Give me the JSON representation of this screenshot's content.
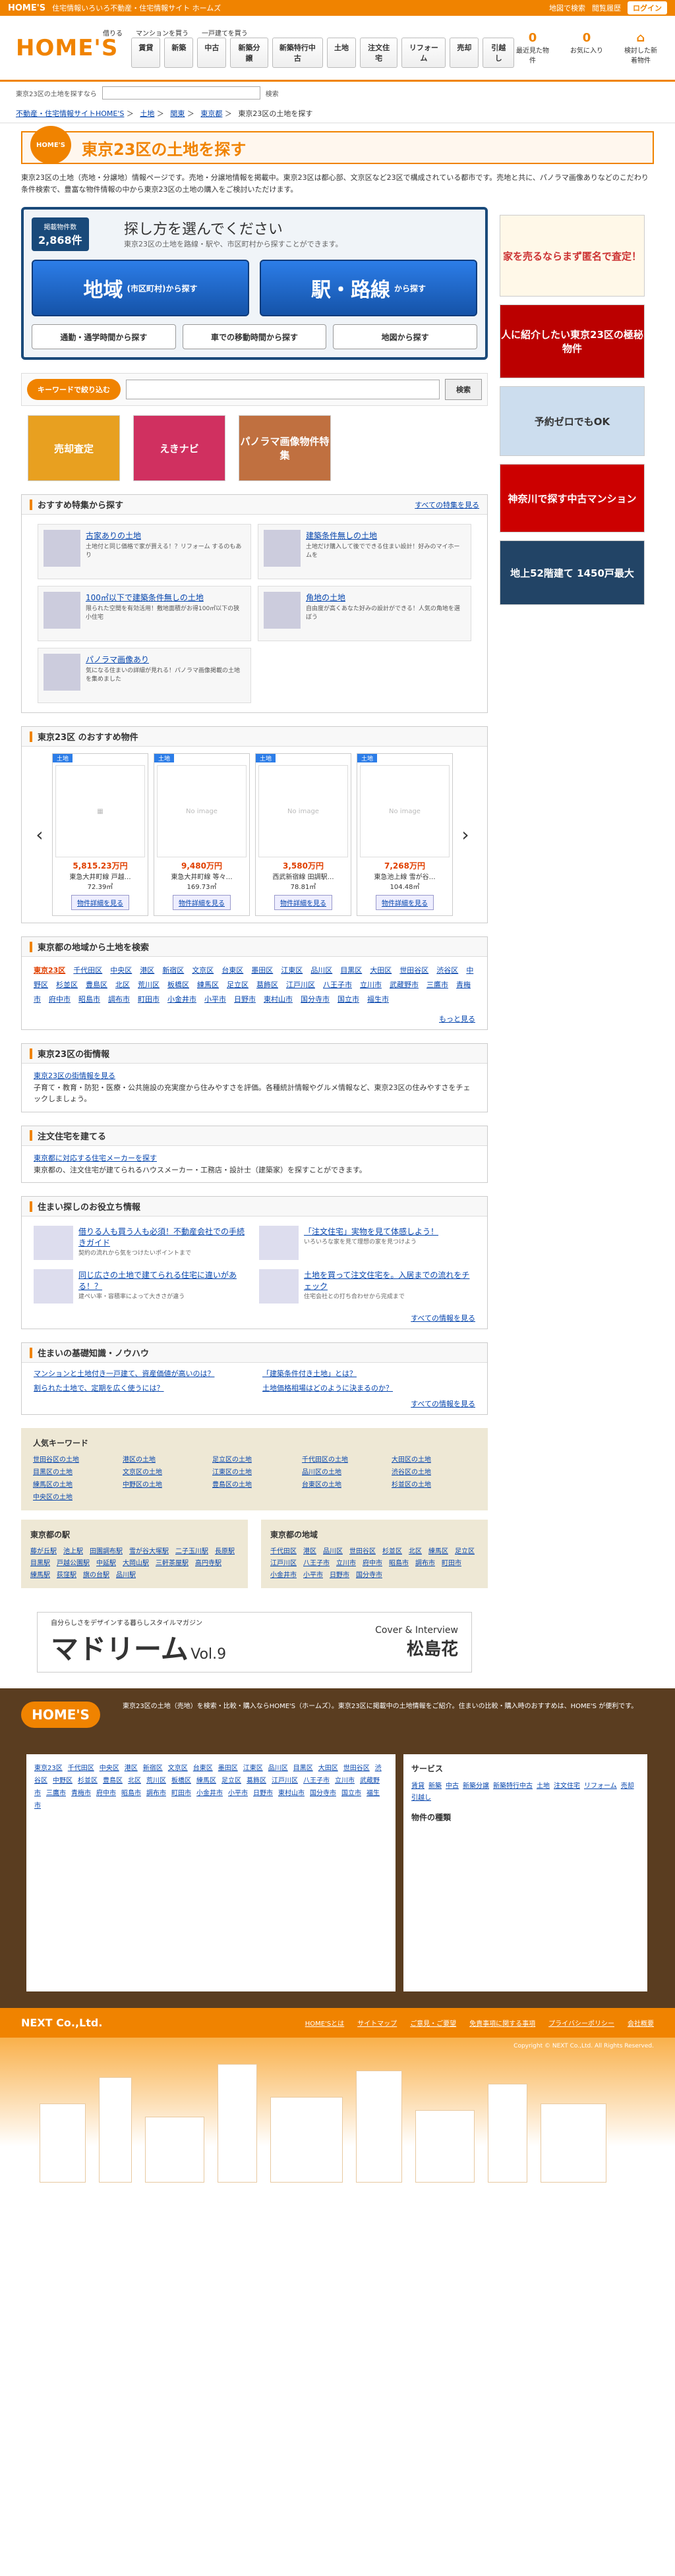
{
  "topbar": {
    "brand": "HOME'S",
    "tagline": "住宅情報いろいろ不動産・住宅情報サイト ホームズ",
    "links": [
      "地図で検索",
      "閲覧履歴",
      "ログイン"
    ]
  },
  "header": {
    "logo": "HOME'S",
    "upper": [
      "借りる",
      "マンションを買う",
      "一戸建てを買う"
    ],
    "nav": [
      "賃貸",
      "新築",
      "中古",
      "新築分譲",
      "新築特行中古",
      "土地",
      "注文住宅",
      "リフォーム",
      "売却",
      "引越し"
    ],
    "icons": [
      {
        "num": "0",
        "label": "最近見た物件"
      },
      {
        "num": "0",
        "label": "お気に入り"
      },
      {
        "num": "",
        "label": "検討した新着物件"
      }
    ]
  },
  "searchline": {
    "text": "東京23区の土地を探すなら",
    "placeholder": "",
    "btn": "検索"
  },
  "breadcrumb": [
    "不動産・住宅情報サイトHOME'S",
    "土地",
    "関東",
    "東京都",
    "東京23区の土地を探す"
  ],
  "title": "東京23区の土地を探す",
  "intro": "東京23区の土地（売地・分譲地）情報ページです。売地・分譲地情報を掲載中。東京23区は都心部、文京区など23区で構成されている都市です。売地と共に、パノラマ画像ありなどのこだわり条件検索で、豊富な物件情報の中から東京23区の土地の購入をご検討いただけます。",
  "select": {
    "count_label": "掲載物件数",
    "count": "2,868件",
    "title": "探し方を選んでください",
    "sub": "東京23区の土地を路線・駅や、市区町村から探すことができます。",
    "area": "地域",
    "area_small": "(市区町村)から探す",
    "station": "駅・路線",
    "station_small": "から探す",
    "subs": [
      "通勤・通学時間から探す",
      "車での移動時間から探す",
      "地図から探す"
    ]
  },
  "keyword": {
    "label": "キーワードで絞り込む",
    "btn": "検索"
  },
  "banners": [
    "売却査定",
    "えきナビ",
    "パノラマ画像物件特集"
  ],
  "features": {
    "title": "おすすめ特集から探す",
    "more": "すべての特集を見る",
    "items": [
      {
        "t": "古家ありの土地",
        "d": "土地付と同じ価格で家が買える！？リフォーム するのもあり"
      },
      {
        "t": "建築条件無しの土地",
        "d": "土地だけ購入して後でできる住まい設計！好みのマイホームを"
      },
      {
        "t": "100㎡以下で建築条件無しの土地",
        "d": "限られた空間を有効活用！敷地面積がお得100㎡以下の狭小住宅"
      },
      {
        "t": "角地の土地",
        "d": "自由度が高くあなた好みの設計ができる！人気の角地を選ぼう"
      },
      {
        "t": "パノラマ画像あり",
        "d": "気になる住まいの詳細が見れる！パノラマ画像掲載の土地を集めました"
      }
    ]
  },
  "recommend": {
    "title": "東京23区 のおすすめ物件",
    "detail": "物件詳細を見る",
    "items": [
      {
        "price": "5,815.23万円",
        "name": "東急大井町線 戸越…",
        "area": "72.39㎡"
      },
      {
        "price": "9,480万円",
        "name": "東急大井町線 等々…",
        "area": "169.73㎡"
      },
      {
        "price": "3,580万円",
        "name": "西武新宿線 田調駅…",
        "area": "78.81㎡"
      },
      {
        "price": "7,268万円",
        "name": "東急池上線 雪が谷…",
        "area": "104.48㎡"
      }
    ]
  },
  "areas": {
    "title": "東京都の地域から土地を検索",
    "more": "もっと見る",
    "items": [
      "東京23区",
      "千代田区",
      "中央区",
      "港区",
      "新宿区",
      "文京区",
      "台東区",
      "墨田区",
      "江東区",
      "品川区",
      "目黒区",
      "大田区",
      "世田谷区",
      "渋谷区",
      "中野区",
      "杉並区",
      "豊島区",
      "北区",
      "荒川区",
      "板橋区",
      "練馬区",
      "足立区",
      "葛飾区",
      "江戸川区",
      "八王子市",
      "立川市",
      "武蔵野市",
      "三鷹市",
      "青梅市",
      "府中市",
      "昭島市",
      "調布市",
      "町田市",
      "小金井市",
      "小平市",
      "日野市",
      "東村山市",
      "国分寺市",
      "国立市",
      "福生市"
    ]
  },
  "info1": {
    "title": "東京23区の街情報",
    "link": "東京23区の街情報を見る",
    "text": "子育て・教育・防犯・医療・公共施設の充実度から住みやすさを評価。各種統計情報やグルメ情報など、東京23区の住みやすさをチェックしましょう。"
  },
  "info2": {
    "title": "注文住宅を建てる",
    "link": "東京都に対応する住宅メーカーを探す",
    "text": "東京都の、注文住宅が建てられるハウスメーカー・工務店・設計士（建築家）を探すことができます。"
  },
  "help": {
    "title": "住まい探しのお役立ち情報",
    "more": "すべての情報を見る",
    "items": [
      {
        "t": "借りる人も買う人も必須！不動産会社での手続きガイド",
        "d": "契約の流れから気をつけたいポイントまで"
      },
      {
        "t": "「注文住宅」実物を見て体感しよう！",
        "d": "いろいろな家を見て理想の家を見つけよう"
      },
      {
        "t": "同じ広さの土地で建てられる住宅に違いがある！？",
        "d": "建ぺい率・容積率によって大きさが違う"
      },
      {
        "t": "土地を買って注文住宅を。入居までの流れをチェック",
        "d": "住宅会社との打ち合わせから完成まで"
      }
    ]
  },
  "knowhow": {
    "title": "住まいの基礎知識・ノウハウ",
    "more": "すべての情報を見る",
    "items": [
      "マンションと土地付き一戸建て、資産価値が高いのは？",
      "「建築条件付き土地」とは？",
      "割られた土地で、定期を広く使うには？",
      "土地価格相場はどのように決まるのか？"
    ]
  },
  "popular": {
    "title": "人気キーワード",
    "items": [
      "世田谷区の土地",
      "港区の土地",
      "足立区の土地",
      "千代田区の土地",
      "大田区の土地",
      "目黒区の土地",
      "文京区の土地",
      "江東区の土地",
      "品川区の土地",
      "渋谷区の土地",
      "練馬区の土地",
      "中野区の土地",
      "豊島区の土地",
      "台東区の土地",
      "杉並区の土地",
      "中央区の土地"
    ]
  },
  "stations": {
    "title": "東京都の駅",
    "items": [
      "藤が丘駅",
      "池上駅",
      "田園調布駅",
      "雪が谷大塚駅",
      "二子玉川駅",
      "長原駅",
      "目黒駅",
      "戸越公園駅",
      "中延駅",
      "大岡山駅",
      "三軒茶屋駅",
      "高円寺駅",
      "練馬駅",
      "荻窪駅",
      "旗の台駅",
      "品川駅"
    ]
  },
  "wards": {
    "title": "東京都の地域",
    "items": [
      "千代田区",
      "港区",
      "品川区",
      "世田谷区",
      "杉並区",
      "北区",
      "練馬区",
      "足立区",
      "江戸川区",
      "八王子市",
      "立川市",
      "府中市",
      "昭島市",
      "調布市",
      "町田市",
      "小金井市",
      "小平市",
      "日野市",
      "国分寺市"
    ]
  },
  "adbanner": {
    "sub": "自分らしさをデザインする暮らしスタイルマガジン",
    "big": "マドリーム",
    "vol": "Vol.9",
    "cover": "Cover & Interview",
    "name": "松島花"
  },
  "sideads": [
    "家を売るならまず匿名で査定！",
    "人に紹介したい東京23区の極秘物件",
    "予約ゼロでもOK",
    "神奈川で探す中古マンション",
    "地上52階建て 1450戸最大"
  ],
  "footer": {
    "logo": "HOME'S",
    "desc": "東京23区の土地（売地）を検索・比較・購入ならHOME'S（ホームズ）。東京23区に掲載中の土地情報をご紹介。住まいの比較・購入時のおすすめは、HOME'S が便利です。",
    "side_title": "サービス",
    "side_title2": "物件の種類",
    "company": "NEXT Co.,Ltd.",
    "links": [
      "HOME'Sとは",
      "サイトマップ",
      "ご意見・ご要望",
      "免責事項に関する事項",
      "プライバシーポリシー",
      "会社概要"
    ],
    "copy": "Copyright © NEXT Co.,Ltd. All Rights Reserved."
  }
}
